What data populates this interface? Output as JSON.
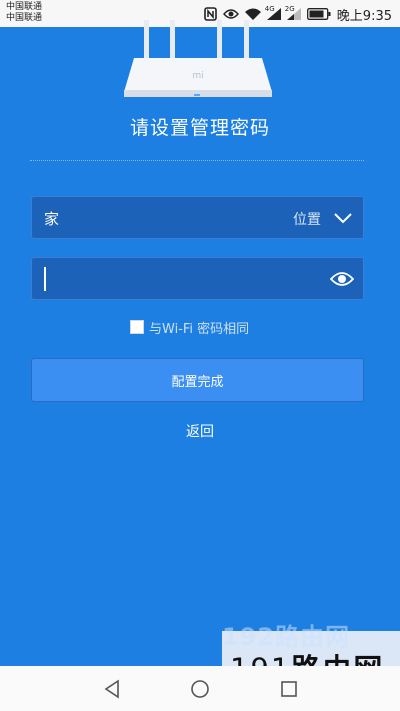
{
  "status_bar": {
    "carrier1": "中国联通",
    "carrier2": "中国联通",
    "time_text": "晚上9:35",
    "network1": "4G",
    "network2": "2G",
    "icons": [
      "nfc-icon",
      "eye-icon",
      "wifi-icon",
      "signal-icon",
      "signal-icon",
      "battery-icon"
    ]
  },
  "headline": "请设置管理密码",
  "location": {
    "value": "家",
    "hint": "位置"
  },
  "password": {
    "value": ""
  },
  "same_as_wifi": {
    "label": "与Wi-Fi 密码相同",
    "checked": false
  },
  "primary_button": "配置完成",
  "back_link": "返回",
  "watermark": {
    "top": "192路由网",
    "main_num": "191",
    "main_text": "路由网"
  },
  "colors": {
    "background": "#1d7fe1",
    "field": "#1b62b8",
    "button": "#3c8ff2"
  }
}
